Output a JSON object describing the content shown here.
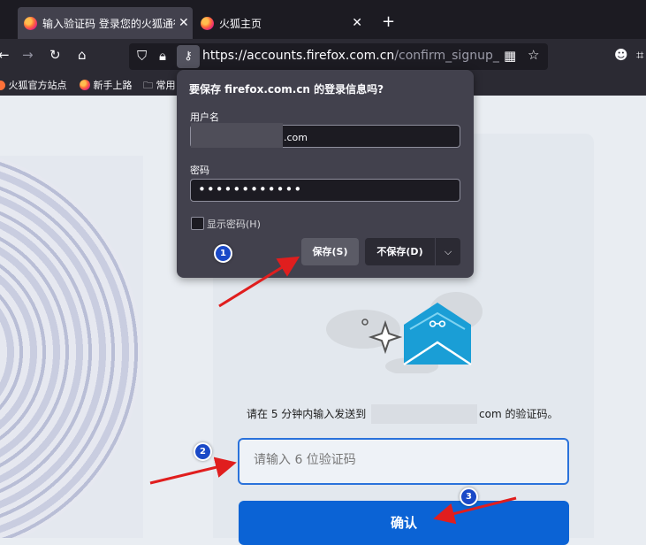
{
  "browser": {
    "tabs": [
      {
        "title": "输入验证码 登录您的火狐通行证",
        "close": "✕",
        "active": true
      },
      {
        "title": "火狐主页",
        "close": "✕",
        "active": false
      }
    ],
    "new_tab": "+",
    "url_host": "https://accounts.firefox.com.cn",
    "url_path": "/confirm_signup_code?co",
    "nav_icons": [
      "back-icon",
      "forward-icon",
      "reload-icon",
      "home-icon",
      "shield-icon",
      "lock-icon",
      "key-icon",
      "qrcode-icon",
      "star-icon",
      "account-icon",
      "crop-icon"
    ]
  },
  "bookmarks": [
    {
      "label": "火狐官方站点"
    },
    {
      "label": "新手上路"
    },
    {
      "label": "常用"
    }
  ],
  "popup": {
    "title": "要保存 firefox.com.cn 的登录信息吗?",
    "username_label": "用户名",
    "username_value": ".com",
    "password_label": "密码",
    "password_value": "••••••••••••",
    "show_password": "显示密码(H)",
    "save_button": "保存(S)",
    "dont_save_button": "不保存(D)",
    "menu_chevron": "⌵"
  },
  "page": {
    "instruction_prefix": "请在 5 分钟内输入发送到",
    "instruction_suffix": "com 的验证码。",
    "code_placeholder": "请输入 6 位验证码",
    "confirm_button": "确认"
  },
  "annotations": {
    "badges": [
      "1",
      "2",
      "3"
    ],
    "color": "#e01e1e"
  }
}
